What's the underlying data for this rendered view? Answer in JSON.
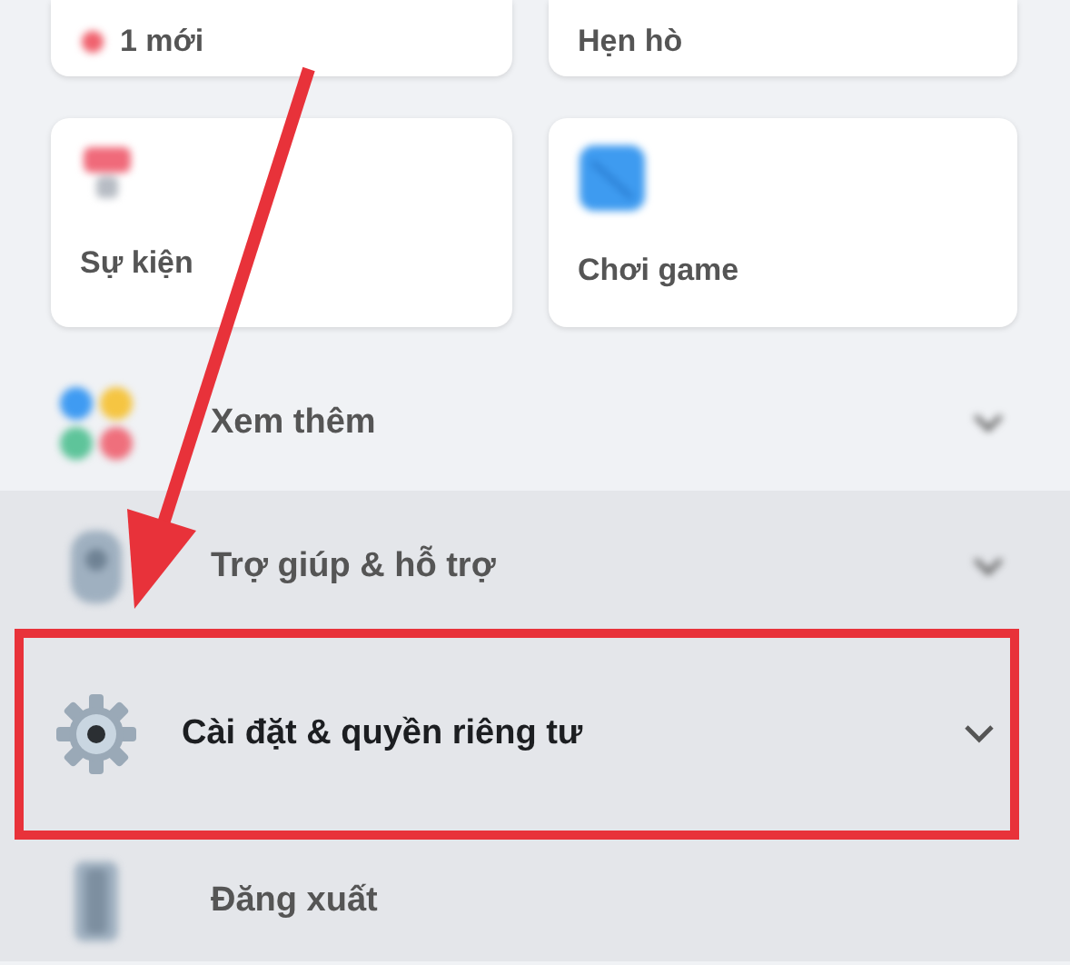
{
  "shortcut_cards": [
    {
      "label": "1 mới"
    },
    {
      "label": "Hẹn hò"
    },
    {
      "label": "Sự kiện"
    },
    {
      "label": "Chơi game"
    }
  ],
  "menu_items": [
    {
      "label": "Xem thêm",
      "kind": "section",
      "expanded": false,
      "annotated": false
    },
    {
      "label": "Trợ giúp & hỗ trợ",
      "kind": "section",
      "expanded": false,
      "annotated": false
    },
    {
      "label": "Cài đặt & quyền riêng tư",
      "kind": "section",
      "expanded": false,
      "annotated": true
    },
    {
      "label": "Đăng xuất",
      "kind": "action",
      "annotated": false
    }
  ],
  "callout_arrow": true
}
